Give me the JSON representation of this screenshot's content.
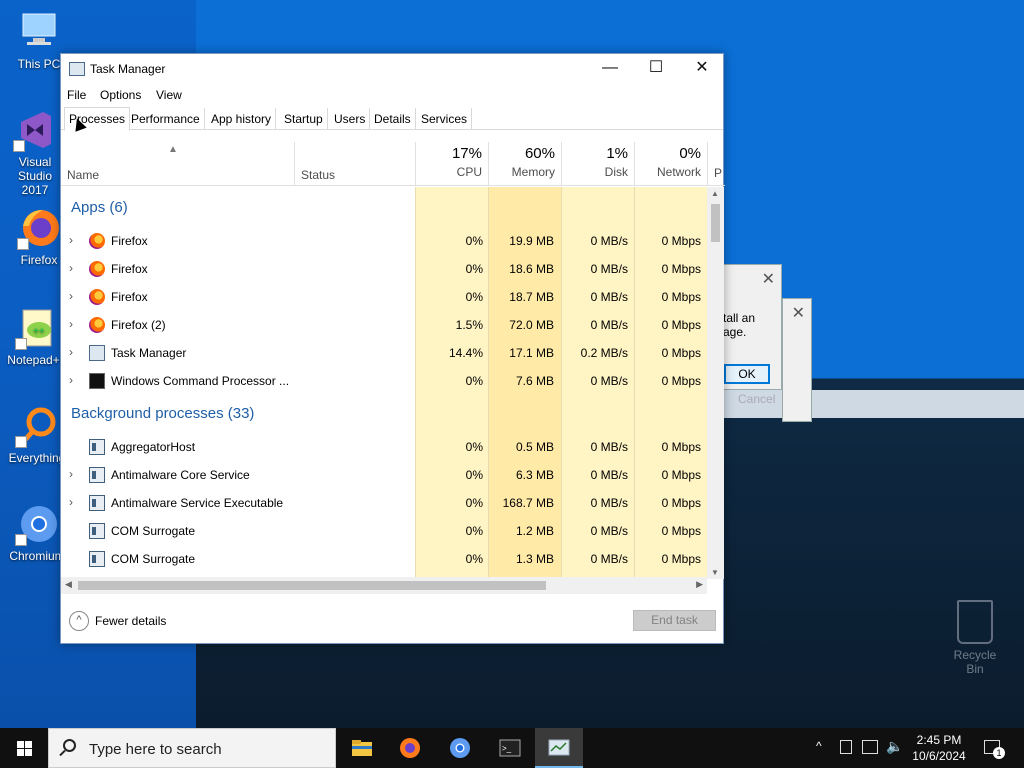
{
  "desktop": {
    "icons": [
      {
        "label": "This PC"
      },
      {
        "label": "Visual Studio 2017"
      },
      {
        "label": "Firefox"
      },
      {
        "label": "Notepad++"
      },
      {
        "label": "Everything"
      },
      {
        "label": "Chromium"
      }
    ],
    "recycle_bin": "Recycle Bin",
    "bg_dialog_text_1": "tall an",
    "bg_dialog_text_2": "age.",
    "bg_ok": "OK",
    "bg_cancel": "Cancel"
  },
  "window": {
    "title": "Task Manager",
    "minimize": "—",
    "maximize": "☐",
    "close": "✕"
  },
  "menu": [
    "File",
    "Options",
    "View"
  ],
  "tabs": [
    "Processes",
    "Performance",
    "App history",
    "Startup",
    "Users",
    "Details",
    "Services"
  ],
  "active_tab": "Processes",
  "columns": {
    "name": "Name",
    "status": "Status",
    "cpu": {
      "pct": "17%",
      "label": "CPU"
    },
    "memory": {
      "pct": "60%",
      "label": "Memory"
    },
    "disk": {
      "pct": "1%",
      "label": "Disk"
    },
    "network": {
      "pct": "0%",
      "label": "Network"
    },
    "power": "P"
  },
  "sections": {
    "apps": "Apps (6)",
    "background": "Background processes (33)"
  },
  "apps": [
    {
      "name": "Firefox",
      "icon": "firefox-icon",
      "cpu": "0%",
      "memory": "19.9 MB",
      "disk": "0 MB/s",
      "network": "0 Mbps"
    },
    {
      "name": "Firefox",
      "icon": "firefox-icon",
      "cpu": "0%",
      "memory": "18.6 MB",
      "disk": "0 MB/s",
      "network": "0 Mbps"
    },
    {
      "name": "Firefox",
      "icon": "firefox-icon",
      "cpu": "0%",
      "memory": "18.7 MB",
      "disk": "0 MB/s",
      "network": "0 Mbps"
    },
    {
      "name": "Firefox (2)",
      "icon": "firefox-icon",
      "cpu": "1.5%",
      "memory": "72.0 MB",
      "disk": "0 MB/s",
      "network": "0 Mbps"
    },
    {
      "name": "Task Manager",
      "icon": "task-manager-icon",
      "cpu": "14.4%",
      "memory": "17.1 MB",
      "disk": "0.2 MB/s",
      "network": "0 Mbps"
    },
    {
      "name": "Windows Command Processor ...",
      "icon": "cmd-icon",
      "cpu": "0%",
      "memory": "7.6 MB",
      "disk": "0 MB/s",
      "network": "0 Mbps"
    }
  ],
  "background": [
    {
      "name": "AggregatorHost",
      "cpu": "0%",
      "memory": "0.5 MB",
      "disk": "0 MB/s",
      "network": "0 Mbps"
    },
    {
      "name": "Antimalware Core Service",
      "cpu": "0%",
      "memory": "6.3 MB",
      "disk": "0 MB/s",
      "network": "0 Mbps"
    },
    {
      "name": "Antimalware Service Executable",
      "cpu": "0%",
      "memory": "168.7 MB",
      "disk": "0 MB/s",
      "network": "0 Mbps"
    },
    {
      "name": "COM Surrogate",
      "cpu": "0%",
      "memory": "1.2 MB",
      "disk": "0 MB/s",
      "network": "0 Mbps"
    },
    {
      "name": "COM Surrogate",
      "cpu": "0%",
      "memory": "1.3 MB",
      "disk": "0 MB/s",
      "network": "0 Mbps"
    }
  ],
  "footer": {
    "fewer_details": "Fewer details",
    "end_task": "End task"
  },
  "taskbar": {
    "search_placeholder": "Type here to search",
    "time": "2:45 PM",
    "date": "10/6/2024",
    "notification_count": "1"
  }
}
